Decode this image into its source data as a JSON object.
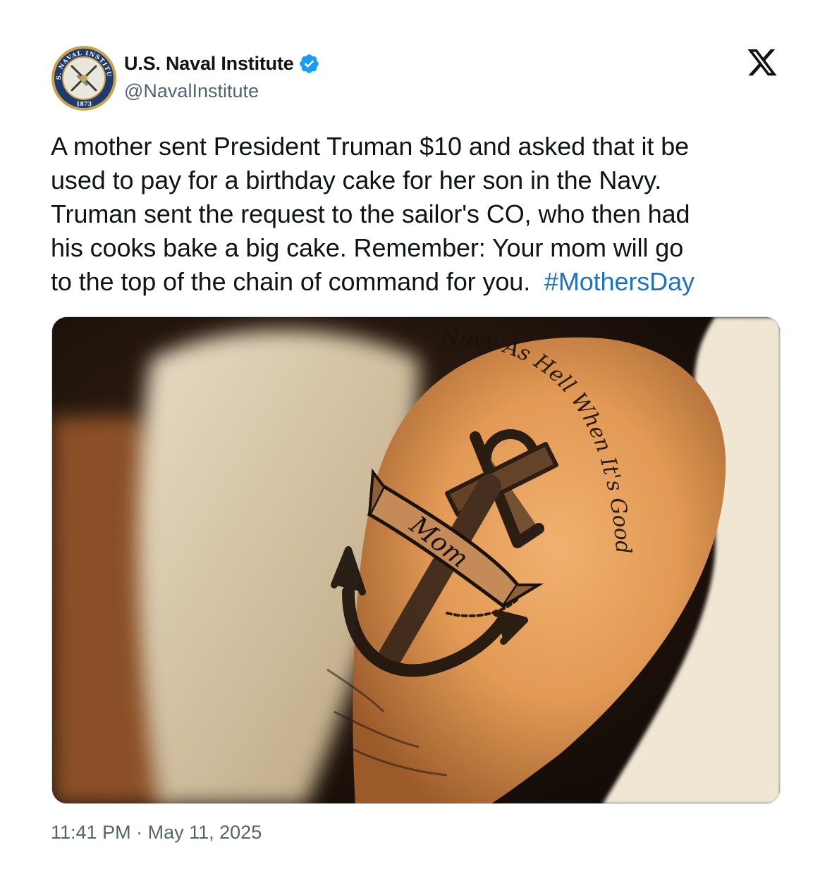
{
  "author": {
    "display_name": "U.S. Naval Institute",
    "handle": "@NavalInstitute",
    "verified": true,
    "avatar_icon": "naval-institute-seal",
    "avatar_text": [
      "U.S. NAVAL INSTITUTE",
      "1873"
    ]
  },
  "platform": {
    "logo_icon": "x-logo-icon"
  },
  "tweet": {
    "text_lines": [
      "A mother sent President Truman $10 and asked that it be",
      "used to pay for a birthday cake for her son in the Navy.",
      "Truman sent the request to the sailor's CO, who then had",
      "his cooks bake a big cake. Remember: Your mom will go",
      "to the top of the chain of command for you. "
    ],
    "hashtag": "#MothersDay",
    "link_color": "#1a73c9"
  },
  "media": {
    "type": "photo",
    "subject": "anchor-tattoo-on-shoulder",
    "tattoo_banner_text": "Mom",
    "tattoo_script_text": "Navy As Hell When It's Good"
  },
  "meta": {
    "time": "11:41 PM",
    "separator": "·",
    "date": "May 11, 2025"
  },
  "colors": {
    "text": "#0f1419",
    "secondary": "#536471",
    "verified": "#1d9bf0",
    "border": "#cfd9de"
  }
}
